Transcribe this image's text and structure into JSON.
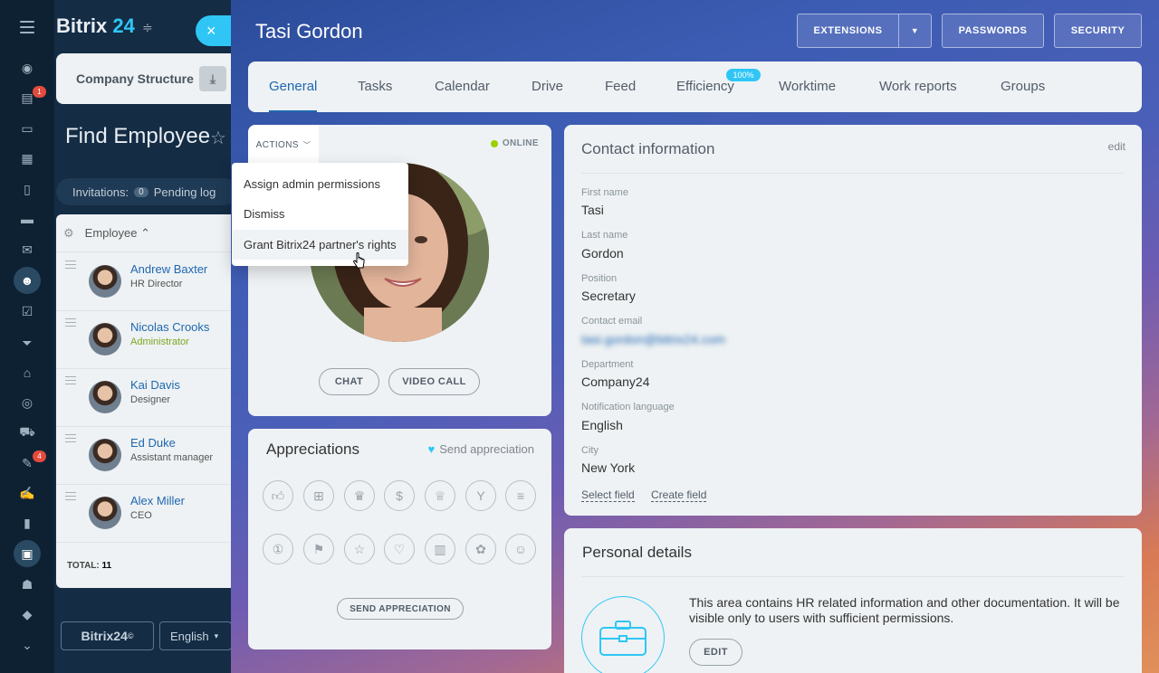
{
  "app": {
    "brand_main": "Bitrix",
    "brand_num": "24",
    "close": "×"
  },
  "sidebar": {
    "badges": [
      "1",
      "4"
    ]
  },
  "bg": {
    "company_structure": "Company Structure",
    "find_title": "Find Employee",
    "invitations_label": "Invitations:",
    "invitations_count": "0",
    "pending": "Pending log",
    "employee_col": "Employee",
    "total_label": "TOTAL:",
    "total_value": "11",
    "employees": [
      {
        "name": "Andrew Baxter",
        "role": "HR Director"
      },
      {
        "name": "Nicolas Crooks",
        "role": "Administrator"
      },
      {
        "name": "Kai Davis",
        "role": "Designer"
      },
      {
        "name": "Ed Duke",
        "role": "Assistant manager"
      },
      {
        "name": "Alex Miller",
        "role": "CEO"
      }
    ],
    "footer_logo": "Bitrix24",
    "footer_lang": "English"
  },
  "slider": {
    "title": "Tasi Gordon",
    "buttons": {
      "extensions": "EXTENSIONS",
      "passwords": "PASSWORDS",
      "security": "SECURITY"
    },
    "tabs": [
      "General",
      "Tasks",
      "Calendar",
      "Drive",
      "Feed",
      "Efficiency",
      "Worktime",
      "Work reports",
      "Groups"
    ],
    "efficiency_badge": "100%"
  },
  "profile": {
    "actions": "ACTIONS",
    "status": "ONLINE",
    "chat": "CHAT",
    "video_call": "VIDEO CALL"
  },
  "actions_menu": [
    "Assign admin permissions",
    "Dismiss",
    "Grant Bitrix24 partner's rights"
  ],
  "contact": {
    "title": "Contact information",
    "edit": "edit",
    "fields": [
      {
        "label": "First name",
        "value": "Tasi"
      },
      {
        "label": "Last name",
        "value": "Gordon"
      },
      {
        "label": "Position",
        "value": "Secretary"
      },
      {
        "label": "Contact email",
        "value": "tasi.gordon@bitrix24.com"
      },
      {
        "label": "Department",
        "value": "Company24"
      },
      {
        "label": "Notification language",
        "value": "English"
      },
      {
        "label": "City",
        "value": "New York"
      }
    ],
    "select_field": "Select field",
    "create_field": "Create field"
  },
  "appreciations": {
    "title": "Appreciations",
    "send_link": "Send appreciation",
    "send_button": "SEND APPRECIATION",
    "icons": [
      "thumbs-up",
      "gift",
      "trophy",
      "money-bag",
      "crown",
      "cocktail",
      "cake",
      "medal-one",
      "flag",
      "star",
      "heart",
      "beer",
      "flower",
      "smile"
    ]
  },
  "personal": {
    "title": "Personal details",
    "text": "This area contains HR related information and other documentation. It will be visible only to users with sufficient permissions.",
    "edit": "EDIT"
  },
  "colors": {
    "accent": "#2fc6f6",
    "link": "#2067b0",
    "online": "#9dcf00",
    "badge": "#e34b3d"
  }
}
